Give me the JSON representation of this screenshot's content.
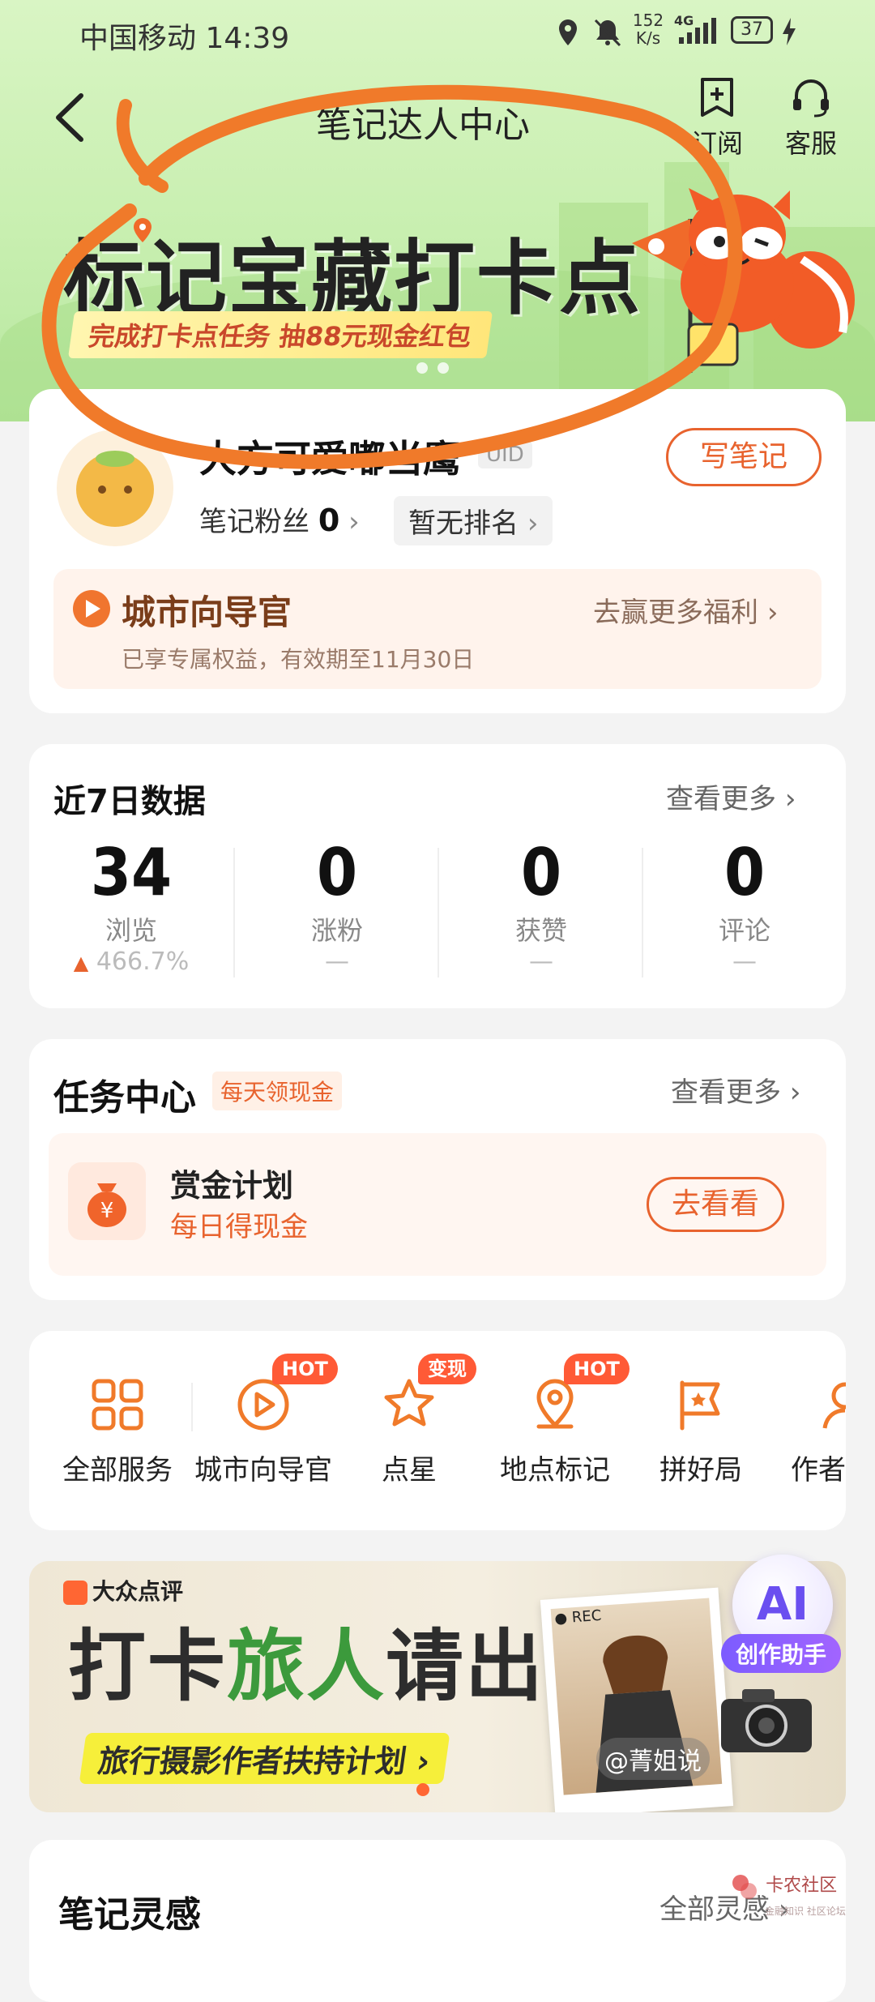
{
  "status_bar": {
    "carrier_time": "中国移动 14:39",
    "speed_top": "152",
    "speed_bottom": "K/s",
    "net": "4G",
    "battery": "37"
  },
  "header": {
    "title": "笔记达人中心",
    "subscribe_label": "订阅",
    "service_label": "客服"
  },
  "banner": {
    "title": "标记宝藏打卡点",
    "subtitle": "完成打卡点任务 抽88元现金红包"
  },
  "profile": {
    "name": "大方可爱嘟当鹰",
    "uid_label": "UID",
    "fans_label": "笔记粉丝",
    "fans_count": "0",
    "rank_label": "暂无排名",
    "write_note_label": "写笔记"
  },
  "guide": {
    "title": "城市向导官",
    "link": "去赢更多福利",
    "desc": "已享专属权益，有效期至11月30日"
  },
  "stats": {
    "title": "近7日数据",
    "more": "查看更多",
    "items": [
      {
        "value": "34",
        "label": "浏览",
        "sub": "466.7%"
      },
      {
        "value": "0",
        "label": "涨粉",
        "sub": "—"
      },
      {
        "value": "0",
        "label": "获赞",
        "sub": "—"
      },
      {
        "value": "0",
        "label": "评论",
        "sub": "—"
      }
    ]
  },
  "tasks": {
    "title": "任务中心",
    "tag": "每天领现金",
    "more": "查看更多",
    "item_title": "赏金计划",
    "item_sub": "每日得现金",
    "item_button": "去看看",
    "item_icon_text": "¥"
  },
  "services": {
    "items": [
      {
        "label": "全部服务",
        "badge": ""
      },
      {
        "label": "城市向导官",
        "badge": "HOT"
      },
      {
        "label": "点星",
        "badge": "变现"
      },
      {
        "label": "地点标记",
        "badge": "HOT"
      },
      {
        "label": "拼好局",
        "badge": ""
      },
      {
        "label": "作者",
        "badge": ""
      }
    ]
  },
  "promo": {
    "brand": "大众点评",
    "title_a": "打卡",
    "title_b": "旅人",
    "title_c": "请出列",
    "subtitle": "旅行摄影作者扶持计划",
    "rec": "REC",
    "handle": "@菁姐说",
    "ai_badge": "AI",
    "ai_label": "创作助手"
  },
  "inspiration": {
    "title": "笔记灵感",
    "more": "全部灵感",
    "watermark_top": "卡农社区",
    "watermark_bottom": "金融知识 社区论坛"
  },
  "colors": {
    "accent": "#e8632e",
    "hero_bg": "#c8efb0",
    "scribble": "#f07a2a"
  }
}
